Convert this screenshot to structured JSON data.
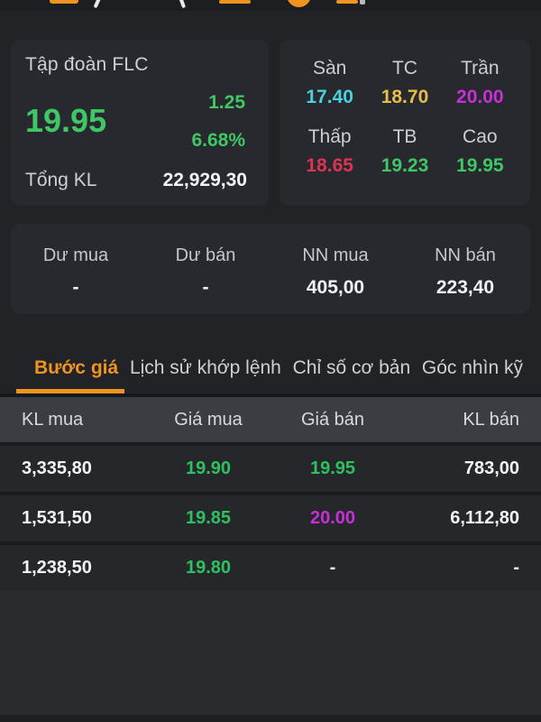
{
  "header": {
    "note": "top app bar cut off at screen edge; orange action icons partially visible"
  },
  "quote": {
    "company": "Tập đoàn FLC",
    "price": "19.95",
    "change": "1.25",
    "change_pct": "6.68%",
    "total_label": "Tổng KL",
    "total_value": "22,929,30"
  },
  "stats": {
    "cells": [
      {
        "label": "Sàn",
        "value": "17.40",
        "color": "#49d2dd"
      },
      {
        "label": "TC",
        "value": "18.70",
        "color": "#e4bd4d"
      },
      {
        "label": "Trần",
        "value": "20.00",
        "color": "#c630d6"
      },
      {
        "label": "Thấp",
        "value": "18.65",
        "color": "#de3353"
      },
      {
        "label": "TB",
        "value": "19.23",
        "color": "#3ec764"
      },
      {
        "label": "Cao",
        "value": "19.95",
        "color": "#3ec764"
      }
    ]
  },
  "summary": {
    "cols": [
      {
        "label": "Dư mua",
        "value": "-"
      },
      {
        "label": "Dư bán",
        "value": "-"
      },
      {
        "label": "NN mua",
        "value": "405,00"
      },
      {
        "label": "NN bán",
        "value": "223,40"
      }
    ]
  },
  "tabs": [
    {
      "label": "Bước giá",
      "active": true
    },
    {
      "label": "Lịch sử khớp lệnh",
      "active": false
    },
    {
      "label": "Chỉ số cơ bản",
      "active": false
    },
    {
      "label": "Góc nhìn kỹ",
      "active": false
    }
  ],
  "table": {
    "headers": [
      "KL mua",
      "Giá mua",
      "Giá bán",
      "KL bán"
    ],
    "rows": [
      {
        "kl_mua": "3,335,80",
        "gia_mua": "19.90",
        "gia_mua_color": "#2fc05f",
        "gia_ban": "19.95",
        "gia_ban_color": "#2fc05f",
        "kl_ban": "783,00"
      },
      {
        "kl_mua": "1,531,50",
        "gia_mua": "19.85",
        "gia_mua_color": "#2fc05f",
        "gia_ban": "20.00",
        "gia_ban_color": "#c630d6",
        "kl_ban": "6,112,80"
      },
      {
        "kl_mua": "1,238,50",
        "gia_mua": "19.80",
        "gia_mua_color": "#2fc05f",
        "gia_ban": "-",
        "gia_ban_color": "#f2f3f5",
        "kl_ban": "-"
      }
    ]
  },
  "colors": {
    "accent_orange": "#ef9421",
    "up_green": "#3ec764",
    "down_red": "#de3353",
    "ceiling_magenta": "#c630d6",
    "floor_cyan": "#49d2dd",
    "reference_yellow": "#e4bd4d",
    "card_bg": "#27292e",
    "page_bg": "#212327"
  }
}
